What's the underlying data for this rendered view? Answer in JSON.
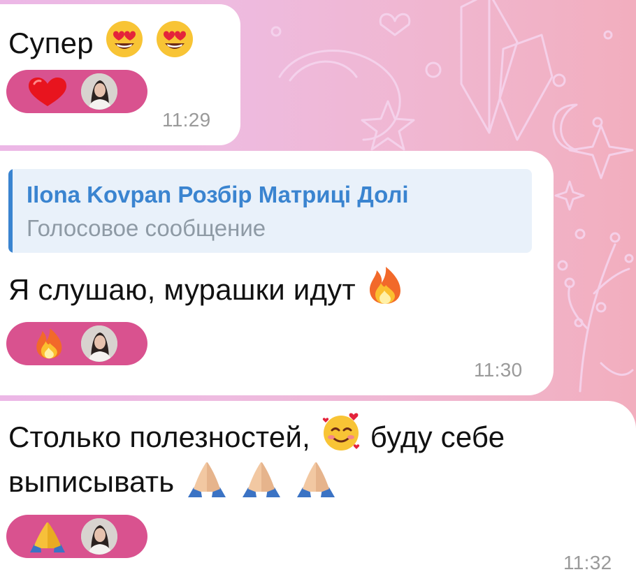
{
  "messages": [
    {
      "text": "Супер",
      "text_emojis": [
        "heart-eyes-emoji",
        "heart-eyes-emoji"
      ],
      "reaction_emoji": "heart-emoji",
      "time": "11:29"
    },
    {
      "reply_to": {
        "name": "Ilona Kovpan Розбір Матриці Долі",
        "text": "Голосовое сообщение"
      },
      "text": "Я слушаю, мурашки идут",
      "text_emojis": [
        "fire-emoji"
      ],
      "reaction_emoji": "fire-emoji",
      "time": "11:30"
    },
    {
      "text_line1": "Столько полезностей,",
      "text_line1_after": "буду себе",
      "text_line2": "выписывать",
      "text_emojis": [
        "smiling-face-with-hearts-emoji",
        "folded-hands-emoji",
        "folded-hands-emoji",
        "folded-hands-emoji"
      ],
      "reaction_emoji": "folded-hands-emoji",
      "time": "11:32"
    }
  ],
  "colors": {
    "bubble": "#ffffff",
    "reaction_pill": "#d9528f",
    "reply_accent": "#3a84d0",
    "reply_bg": "#e9f1fa",
    "time_text": "#9a9a9a"
  }
}
